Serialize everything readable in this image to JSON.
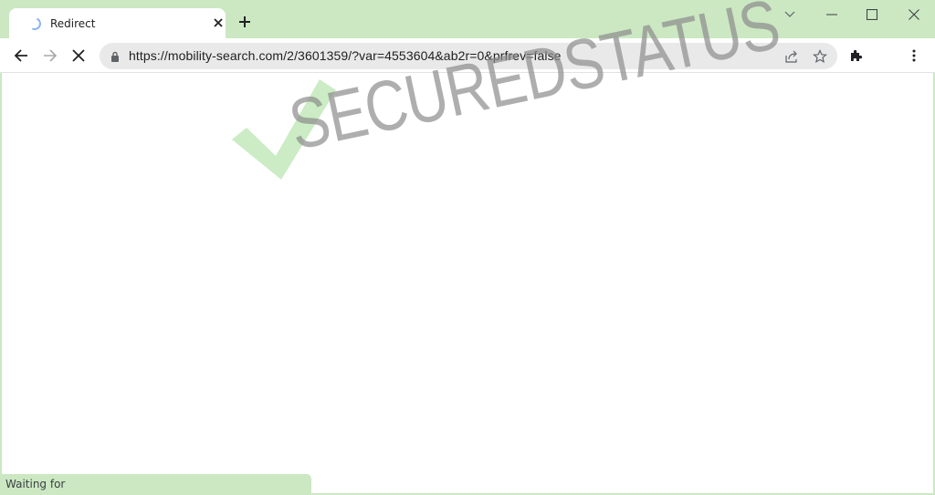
{
  "browser": {
    "tab": {
      "title": "Redirect",
      "loading": true,
      "close_icon": "close-icon"
    },
    "new_tab_icon": "plus-icon",
    "window_controls": {
      "tab_search_icon": "chevron-down-icon",
      "minimize_icon": "minimize-icon",
      "maximize_icon": "maximize-icon",
      "close_icon": "close-icon"
    },
    "toolbar": {
      "back_icon": "arrow-left-icon",
      "forward_icon": "arrow-right-icon",
      "stop_icon": "stop-x-icon",
      "url": "https://mobility-search.com/2/3601359/?var=4553604&ab2r=0&prfrev=false",
      "lock_icon": "lock-icon",
      "share_icon": "share-icon",
      "bookmark_icon": "star-icon",
      "extensions_icon": "puzzle-icon",
      "menu_icon": "kebab-menu-icon"
    },
    "status_bar": {
      "text": "Waiting for"
    }
  },
  "watermark": {
    "text": "SECUREDSTATUS",
    "check_color": "#cbecc4",
    "text_color": "#8c8c8c"
  },
  "colors": {
    "frame": "#cbe8c2",
    "omnibox": "#e9e9e9",
    "spinner": "#8ab4f8"
  }
}
